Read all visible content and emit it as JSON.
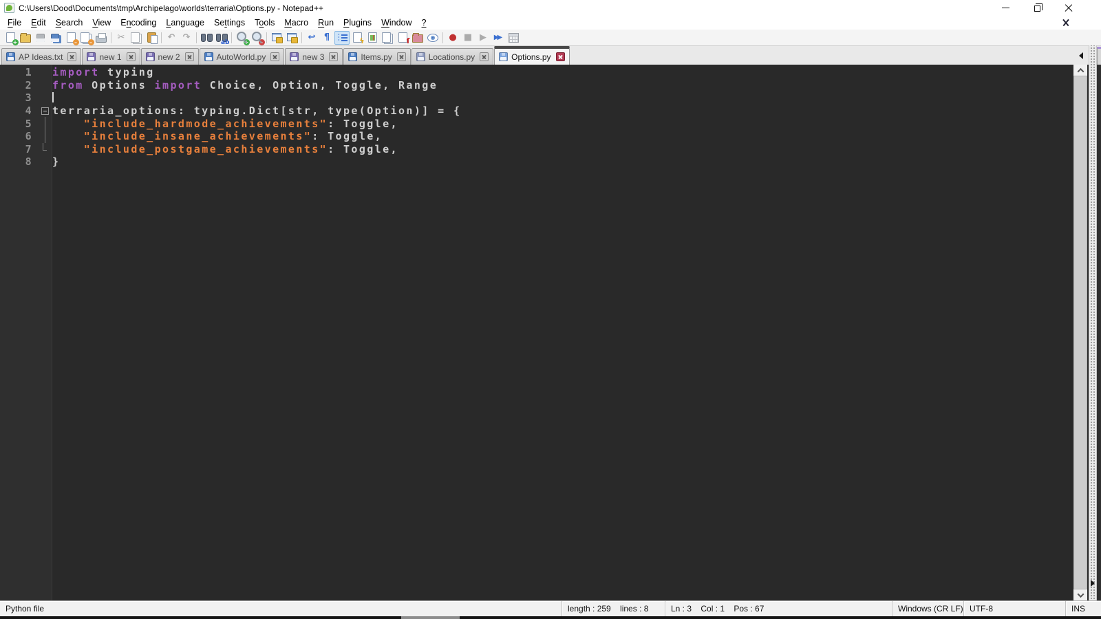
{
  "window": {
    "title": "C:\\Users\\Dood\\Documents\\tmp\\Archipelago\\worlds\\terraria\\Options.py - Notepad++",
    "controls": [
      "minimize",
      "restore",
      "close"
    ]
  },
  "menu": {
    "items": [
      {
        "label": "File",
        "u": 0
      },
      {
        "label": "Edit",
        "u": 0
      },
      {
        "label": "Search",
        "u": 0
      },
      {
        "label": "View",
        "u": 0
      },
      {
        "label": "Encoding",
        "u": 1
      },
      {
        "label": "Language",
        "u": 0
      },
      {
        "label": "Settings",
        "u": 2
      },
      {
        "label": "Tools",
        "u": 1
      },
      {
        "label": "Macro",
        "u": 0
      },
      {
        "label": "Run",
        "u": 0
      },
      {
        "label": "Plugins",
        "u": 0
      },
      {
        "label": "Window",
        "u": 0
      },
      {
        "label": "?",
        "u": 0
      }
    ]
  },
  "toolbar": {
    "buttons": [
      {
        "name": "new-file",
        "kind": "page",
        "badge": "+",
        "badge_color": "#3fae49"
      },
      {
        "name": "open-file",
        "kind": "folder",
        "color": "#e9c45c"
      },
      {
        "name": "save-file",
        "kind": "floppy",
        "color": "#9fa9b8",
        "disabled": true
      },
      {
        "name": "save-all",
        "kind": "floppy2",
        "color": "#5b87c5"
      },
      {
        "name": "close-document",
        "kind": "page",
        "badge": "–",
        "badge_color": "#e8963a"
      },
      {
        "name": "close-all-documents",
        "kind": "page2",
        "badge": "–",
        "badge_color": "#e8963a"
      },
      {
        "name": "print",
        "kind": "printer"
      },
      {
        "sep": true
      },
      {
        "name": "cut",
        "kind": "glyph",
        "glyph": "✂",
        "color": "#8f8f8f",
        "disabled": true
      },
      {
        "name": "copy",
        "kind": "page2",
        "disabled": true
      },
      {
        "name": "paste",
        "kind": "clip"
      },
      {
        "sep": true
      },
      {
        "name": "undo",
        "kind": "glyph",
        "glyph": "↶",
        "color": "#9a9a9a",
        "disabled": true
      },
      {
        "name": "redo",
        "kind": "glyph",
        "glyph": "↷",
        "color": "#9a9a9a",
        "disabled": true
      },
      {
        "sep": true
      },
      {
        "name": "find",
        "kind": "binoc"
      },
      {
        "name": "replace",
        "kind": "binoc",
        "ab": true
      },
      {
        "sep": true
      },
      {
        "name": "zoom-in",
        "kind": "mag",
        "badge": "+",
        "badge_color": "#3fae49"
      },
      {
        "name": "zoom-out",
        "kind": "mag",
        "badge": "–",
        "badge_color": "#cc4444"
      },
      {
        "sep": true
      },
      {
        "name": "synchronize-vertical-scrolling",
        "kind": "sync"
      },
      {
        "name": "synchronize-horizontal-scrolling",
        "kind": "sync"
      },
      {
        "sep": true
      },
      {
        "name": "word-wrap",
        "kind": "glyph",
        "glyph": "↩",
        "color": "#3a6fd0"
      },
      {
        "name": "show-all-characters",
        "kind": "glyph",
        "glyph": "¶",
        "color": "#3a6fd0"
      },
      {
        "name": "show-indent-guide",
        "kind": "ind",
        "pressed": true
      },
      {
        "name": "function-list",
        "kind": "pageflash",
        "mark": "ϟ",
        "mark_color": "#e0a81c"
      },
      {
        "name": "document-map",
        "kind": "docmap"
      },
      {
        "name": "document-switcher",
        "kind": "page2"
      },
      {
        "name": "document-list",
        "kind": "pagescript",
        "mark": "ſ",
        "mark_color": "#cc2222"
      },
      {
        "name": "folder-as-workspace",
        "kind": "folder",
        "color": "#d98a9a"
      },
      {
        "name": "monitoring",
        "kind": "eye"
      },
      {
        "sep": true
      },
      {
        "name": "macro-record",
        "kind": "glyph",
        "glyph": "●",
        "color": "#c03030"
      },
      {
        "name": "macro-stop",
        "kind": "glyph",
        "glyph": "■",
        "color": "#9a9a9a",
        "disabled": true
      },
      {
        "name": "macro-playback",
        "kind": "glyph",
        "glyph": "▶",
        "color": "#9a9a9a",
        "disabled": true
      },
      {
        "name": "macro-run-multiple",
        "kind": "glyph2",
        "glyph": "▶▶",
        "color": "#3a6fd0"
      },
      {
        "name": "macro-save",
        "kind": "grid",
        "disabled": true
      }
    ]
  },
  "tabs": {
    "items": [
      {
        "label": "AP Ideas.txt",
        "floppy": "#4d7fc4"
      },
      {
        "label": "new 1",
        "floppy": "#7a6fb3"
      },
      {
        "label": "new 2",
        "floppy": "#7a6fb3"
      },
      {
        "label": "AutoWorld.py",
        "floppy": "#4d7fc4"
      },
      {
        "label": "new 3",
        "floppy": "#7a6fb3"
      },
      {
        "label": "Items.py",
        "floppy": "#4d7fc4"
      },
      {
        "label": "Locations.py",
        "floppy": "#8f9cc0"
      },
      {
        "label": "Options.py",
        "floppy": "#7fa7e0",
        "active": true
      }
    ]
  },
  "editor": {
    "lines": [
      {
        "num": "1",
        "fold": "",
        "segs": [
          [
            "k",
            "import"
          ],
          [
            "d",
            " typing"
          ]
        ]
      },
      {
        "num": "2",
        "fold": "",
        "segs": [
          [
            "k",
            "from"
          ],
          [
            "d",
            " Options "
          ],
          [
            "k",
            "import"
          ],
          [
            "d",
            " Choice, Option, Toggle, Range"
          ]
        ]
      },
      {
        "num": "3",
        "fold": "",
        "caret": true,
        "segs": []
      },
      {
        "num": "4",
        "fold": "start",
        "segs": [
          [
            "d",
            "terraria_options: typing.Dict[str, type(Option)] = {"
          ]
        ]
      },
      {
        "num": "5",
        "fold": "mid",
        "segs": [
          [
            "d",
            "    "
          ],
          [
            "s",
            "\"include_hardmode_achievements\""
          ],
          [
            "d",
            ": Toggle,"
          ]
        ]
      },
      {
        "num": "6",
        "fold": "mid",
        "segs": [
          [
            "d",
            "    "
          ],
          [
            "s",
            "\"include_insane_achievements\""
          ],
          [
            "d",
            ": Toggle,"
          ]
        ]
      },
      {
        "num": "7",
        "fold": "end",
        "segs": [
          [
            "d",
            "    "
          ],
          [
            "s",
            "\"include_postgame_achievements\""
          ],
          [
            "d",
            ": Toggle,"
          ]
        ]
      },
      {
        "num": "8",
        "fold": "",
        "segs": [
          [
            "d",
            "}"
          ]
        ]
      }
    ]
  },
  "status": {
    "doc_type": "Python file",
    "length_lines": "length : 259    lines : 8",
    "position": "Ln : 3    Col : 1    Pos : 67",
    "eol": "Windows (CR LF)",
    "encoding": "UTF-8",
    "insert_mode": "INS"
  },
  "colors": {
    "keyword": "#a55cc0",
    "string": "#e8803c",
    "text": "#cfcfcf",
    "editor_bg": "#292929",
    "gutter_bg": "#2f2f2f",
    "line_number": "#8f8f8f",
    "caret": "#d8d8d8",
    "active_tab_close": "#b23a53"
  }
}
